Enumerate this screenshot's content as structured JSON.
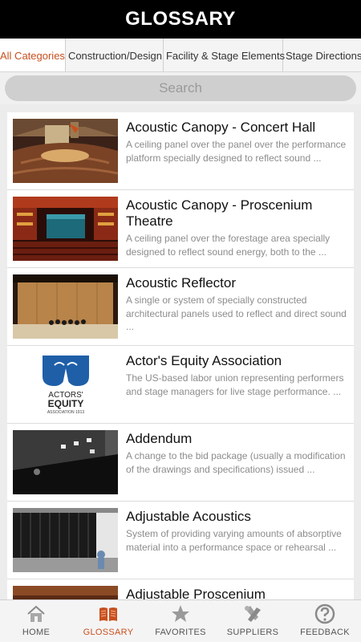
{
  "header": {
    "title": "GLOSSARY"
  },
  "categories": [
    {
      "label": "All Categories",
      "active": true
    },
    {
      "label": "Construction/Design",
      "active": false
    },
    {
      "label": "Facility & Stage Elements",
      "active": false
    },
    {
      "label": "Stage Directions",
      "active": false
    }
  ],
  "search": {
    "placeholder": "Search"
  },
  "entries": [
    {
      "title": "Acoustic Canopy - Concert Hall",
      "desc": "A ceiling panel over the panel over the performance platform specially designed to reflect sound ..."
    },
    {
      "title": "Acoustic Canopy - Proscenium Theatre",
      "desc": "A ceiling panel over the forestage area specially designed to reflect sound energy, both to the ..."
    },
    {
      "title": "Acoustic Reflector",
      "desc": "A single or system of specially constructed architectural panels used to reflect and direct sound ..."
    },
    {
      "title": "Actor's Equity Association",
      "desc": "The US-based labor union representing performers and stage managers for live stage performance.  ...",
      "logo": {
        "line1": "ACTORS'",
        "line2": "EQUITY",
        "line3": "ASSOCIATION 1913"
      }
    },
    {
      "title": "Addendum",
      "desc": "A change to the bid package (usually a modification of the drawings and specifications) issued ..."
    },
    {
      "title": "Adjustable Acoustics",
      "desc": "System of providing varying amounts of absorptive material into a performance space or rehearsal ..."
    },
    {
      "title": "Adjustable Proscenium",
      "desc": ""
    }
  ],
  "tabs": [
    {
      "label": "HOME",
      "icon": "home-icon",
      "active": false
    },
    {
      "label": "GLOSSARY",
      "icon": "book-icon",
      "active": true
    },
    {
      "label": "FAVORITES",
      "icon": "star-icon",
      "active": false
    },
    {
      "label": "SUPPLIERS",
      "icon": "tools-icon",
      "active": false
    },
    {
      "label": "FEEDBACK",
      "icon": "question-icon",
      "active": false
    }
  ],
  "colors": {
    "accent": "#c8501f",
    "header_bg": "#000000",
    "logo_blue": "#1f5fa8"
  }
}
